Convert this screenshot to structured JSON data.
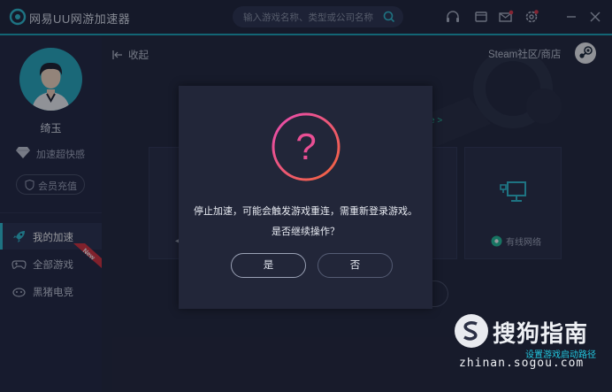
{
  "app": {
    "title": "网易UU网游加速器"
  },
  "search": {
    "placeholder": "输入游戏名称、类型或公司名称"
  },
  "titlebar_icons": [
    "headset-icon",
    "wallet-icon",
    "mail-icon",
    "settings-icon",
    "minimize-icon",
    "close-icon"
  ],
  "user": {
    "name": "绮玉",
    "vip_label": "加速超快感",
    "recharge_label": "会员充值"
  },
  "nav": {
    "items": [
      {
        "label": "我的加速",
        "icon": "rocket-icon",
        "active": true
      },
      {
        "label": "全部游戏",
        "icon": "gamepad-icon",
        "active": false
      },
      {
        "label": "黑猪电竞",
        "icon": "pig-icon",
        "active": false
      }
    ],
    "new_badge": "New"
  },
  "main": {
    "collapse_label": "收起",
    "steam_label": "Steam社区/商店",
    "green_link": "e >",
    "wired_label": "有线网络"
  },
  "dialog": {
    "icon": "question-icon",
    "symbol": "?",
    "message": "停止加速，可能会触发游戏重连，需重新登录游戏。",
    "question": "是否继续操作？",
    "yes_label": "是",
    "no_label": "否"
  },
  "watermark": {
    "brand": "搜狗指南",
    "caption": "设置游戏启动路径",
    "url": "zhinan.sogou.com"
  },
  "colors": {
    "accent": "#1aa7bb",
    "active_nav": "#2fc0d2",
    "green": "#23c29b",
    "dialog_ring_start": "#e84bb2",
    "dialog_ring_end": "#f2643a"
  }
}
